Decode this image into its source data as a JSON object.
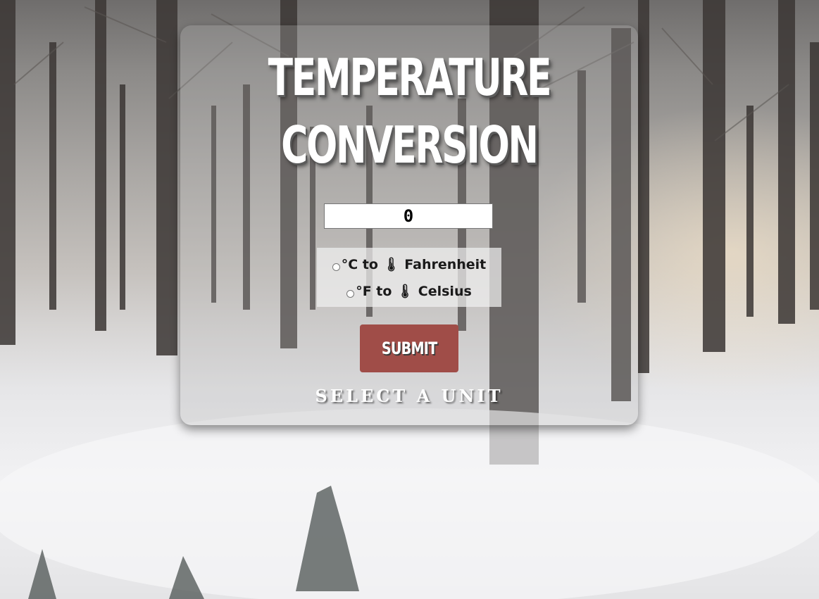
{
  "header": {
    "title_line1": "TEMPERATURE",
    "title_line2": "CONVERSION"
  },
  "input": {
    "value": "0"
  },
  "options": [
    {
      "label": "°C to 🌡 Fahrenheit",
      "selected": false
    },
    {
      "label": "°F to 🌡 Celsius",
      "selected": false
    }
  ],
  "submit": {
    "label": "SUBMIT"
  },
  "result": {
    "text": "SELECT A UNIT"
  },
  "colors": {
    "button": "#a04d48",
    "title": "#ffffff"
  }
}
